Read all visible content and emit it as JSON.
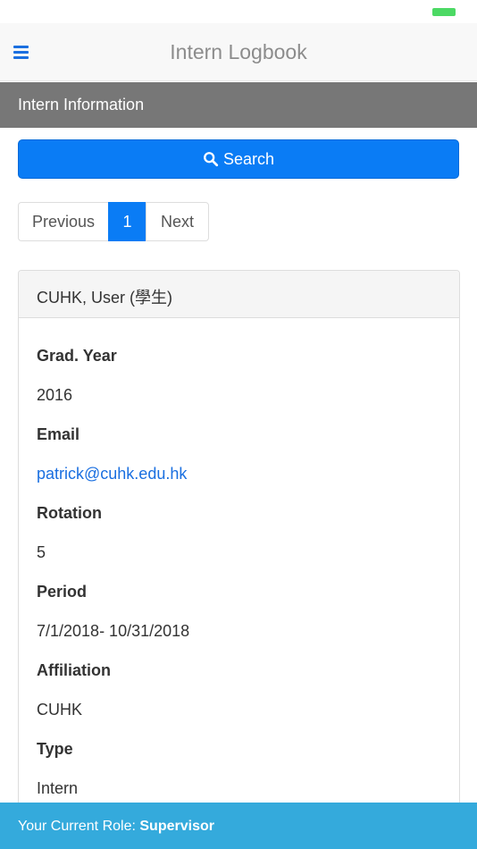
{
  "app": {
    "title": "Intern Logbook"
  },
  "section": {
    "title": "Intern Information"
  },
  "search": {
    "label": "Search"
  },
  "pagination": {
    "previous_label": "Previous",
    "current_page": "1",
    "next_label": "Next"
  },
  "intern": {
    "name": "CUHK, User (學生)",
    "fields": [
      {
        "label": "Grad. Year",
        "value": "2016"
      },
      {
        "label": "Email",
        "value": "patrick@cuhk.edu.hk"
      },
      {
        "label": "Rotation",
        "value": "5"
      },
      {
        "label": "Period",
        "value": "7/1/2018- 10/31/2018"
      },
      {
        "label": "Affiliation",
        "value": "CUHK"
      },
      {
        "label": "Type",
        "value": "Intern"
      }
    ]
  },
  "footer": {
    "role_prefix": "Your Current Role: ",
    "role": "Supervisor"
  },
  "colors": {
    "primary": "#0a7cf5",
    "footer": "#34aadc",
    "section_header": "#777777",
    "link": "#1a6fe0"
  }
}
